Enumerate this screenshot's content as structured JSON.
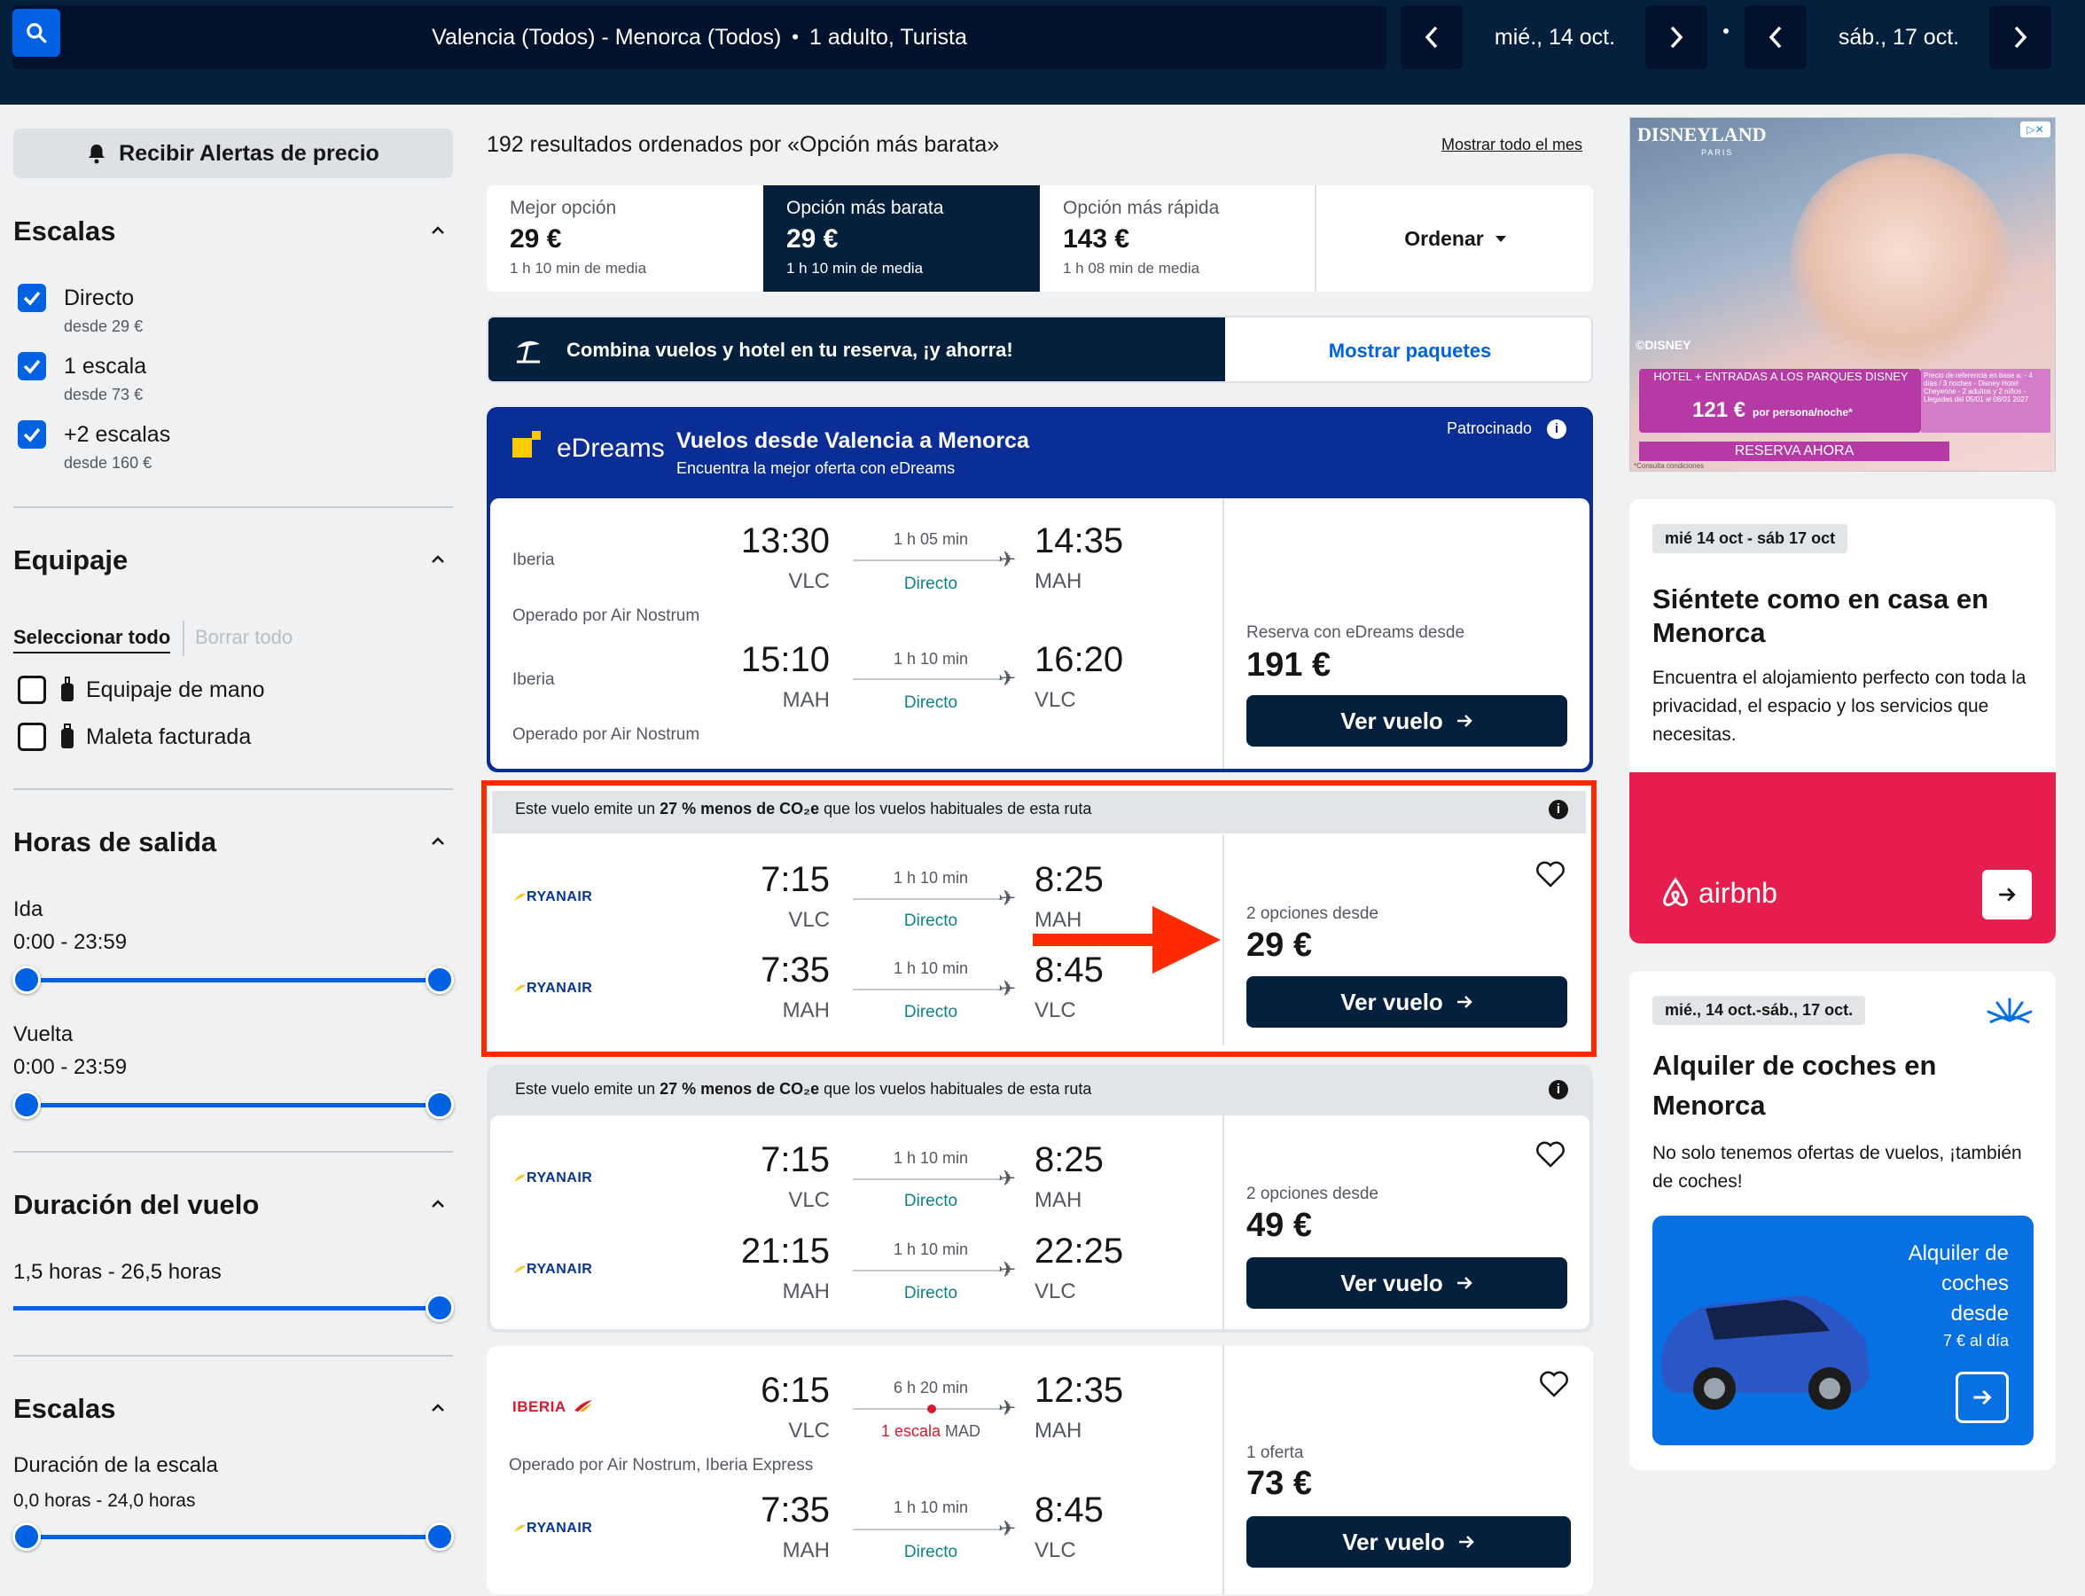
{
  "topbar": {
    "search_summary": "Valencia (Todos) - Menorca (Todos)",
    "passengers": "1 adulto, Turista",
    "depart_date": "mié., 14 oct.",
    "return_date": "sáb., 17 oct."
  },
  "sidebar": {
    "alerts_button": "Recibir Alertas de precio",
    "stops_title": "Escalas",
    "stops": [
      {
        "label": "Directo",
        "sub": "desde 29 €"
      },
      {
        "label": "1 escala",
        "sub": "desde 73 €"
      },
      {
        "label": "+2 escalas",
        "sub": "desde 160 €"
      }
    ],
    "baggage_title": "Equipaje",
    "select_all": "Seleccionar todo",
    "clear_all": "Borrar todo",
    "baggage": [
      {
        "label": "Equipaje de mano"
      },
      {
        "label": "Maleta facturada"
      }
    ],
    "times_title": "Horas de salida",
    "outbound_label": "Ida",
    "outbound_range": "0:00 - 23:59",
    "return_label": "Vuelta",
    "return_range": "0:00 - 23:59",
    "duration_title": "Duración del vuelo",
    "duration_range": "1,5 horas - 26,5 horas",
    "layover_title": "Escalas",
    "layover_label": "Duración de la escala",
    "layover_range": "0,0 horas - 24,0 horas"
  },
  "results": {
    "summary": "192 resultados ordenados por «Opción más barata»",
    "show_month": "Mostrar todo el mes"
  },
  "sort_tabs": [
    {
      "title": "Mejor opción",
      "price": "29 €",
      "duration": "1 h 10 min de media"
    },
    {
      "title": "Opción más barata",
      "price": "29 €",
      "duration": "1 h 10 min de media"
    },
    {
      "title": "Opción más rápida",
      "price": "143 €",
      "duration": "1 h 08 min de media"
    }
  ],
  "sort_button": "Ordenar",
  "package_banner": {
    "text": "Combina vuelos y hotel en tu reserva, ¡y ahorra!",
    "cta": "Mostrar paquetes"
  },
  "sponsored": {
    "brand": "eDreams",
    "title": "Vuelos desde Valencia a Menorca",
    "subtitle": "Encuentra la mejor oferta con eDreams",
    "tag": "Patrocinado",
    "legs": [
      {
        "airline": "Iberia",
        "dep": "13:30",
        "dep_apt": "VLC",
        "dur": "1 h 05 min",
        "stops": "Directo",
        "arr": "14:35",
        "arr_apt": "MAH",
        "operated": "Operado por Air Nostrum"
      },
      {
        "airline": "Iberia",
        "dep": "15:10",
        "dep_apt": "MAH",
        "dur": "1 h 10 min",
        "stops": "Directo",
        "arr": "16:20",
        "arr_apt": "VLC",
        "operated": "Operado por Air Nostrum"
      }
    ],
    "price_label": "Reserva con eDreams desde",
    "price": "191 €",
    "button": "Ver vuelo"
  },
  "co2_note_pre": "Este vuelo emite un ",
  "co2_note_bold": "27 % menos de CO₂e",
  "co2_note_post": " que los vuelos habituales de esta ruta",
  "flights": [
    {
      "legs": [
        {
          "airline": "RYANAIR",
          "dep": "7:15",
          "dep_apt": "VLC",
          "dur": "1 h 10 min",
          "stops": "Directo",
          "arr": "8:25",
          "arr_apt": "MAH"
        },
        {
          "airline": "RYANAIR",
          "dep": "7:35",
          "dep_apt": "MAH",
          "dur": "1 h 10 min",
          "stops": "Directo",
          "arr": "8:45",
          "arr_apt": "VLC"
        }
      ],
      "price_label": "2 opciones desde",
      "price": "29 €",
      "button": "Ver vuelo"
    },
    {
      "legs": [
        {
          "airline": "RYANAIR",
          "dep": "7:15",
          "dep_apt": "VLC",
          "dur": "1 h 10 min",
          "stops": "Directo",
          "arr": "8:25",
          "arr_apt": "MAH"
        },
        {
          "airline": "RYANAIR",
          "dep": "21:15",
          "dep_apt": "MAH",
          "dur": "1 h 10 min",
          "stops": "Directo",
          "arr": "22:25",
          "arr_apt": "VLC"
        }
      ],
      "price_label": "2 opciones desde",
      "price": "49 €",
      "button": "Ver vuelo"
    },
    {
      "legs": [
        {
          "airline": "IBERIA",
          "dep": "6:15",
          "dep_apt": "VLC",
          "dur": "6 h 20 min",
          "stops": "1 escala",
          "stop_apt": "MAD",
          "arr": "12:35",
          "arr_apt": "MAH",
          "operated": "Operado por Air Nostrum, Iberia Express"
        },
        {
          "airline": "RYANAIR",
          "dep": "7:35",
          "dep_apt": "MAH",
          "dur": "1 h 10 min",
          "stops": "Directo",
          "arr": "8:45",
          "arr_apt": "VLC"
        }
      ],
      "price_label": "1 oferta",
      "price": "73 €",
      "button": "Ver vuelo"
    }
  ],
  "ads": {
    "disney": {
      "brand": "DISNEYLAND",
      "brand_sub": "PARIS",
      "copyright": "©DISNEY",
      "offer": "HOTEL + ENTRADAS A LOS PARQUES DISNEY",
      "price": "121 €",
      "price_unit": "por persona/noche*",
      "terms": "Precio de referencia en base a: - 4 días / 3 noches - Disney Hotel Cheyenne - 2 adultos y 2 niños - Llegadas del 05/01 al 08/01 2027",
      "cta": "RESERVA AHORA",
      "fine": "*Consulta condiciones"
    },
    "airbnb": {
      "dates": "mié 14 oct - sáb 17 oct",
      "title": "Siéntete como en casa en Menorca",
      "body": "Encuentra el alojamiento perfecto con toda la privacidad, el espacio y los servicios que necesitas.",
      "brand": "airbnb",
      "color": "#e61e4d"
    },
    "cars": {
      "dates": "mié., 14 oct.-sáb., 17 oct.",
      "title": "Alquiler de coches en Menorca",
      "body": "No solo tenemos ofertas de vuelos, ¡también de coches!",
      "promo_l1": "Alquiler de",
      "promo_l2": "coches",
      "promo_l3": "desde",
      "promo_price": "7 € al día"
    }
  },
  "colors": {
    "nav": "#05203c",
    "accent": "#0062e3",
    "highlight_border": "#ff2a00",
    "arrow": "#ff2a00"
  }
}
